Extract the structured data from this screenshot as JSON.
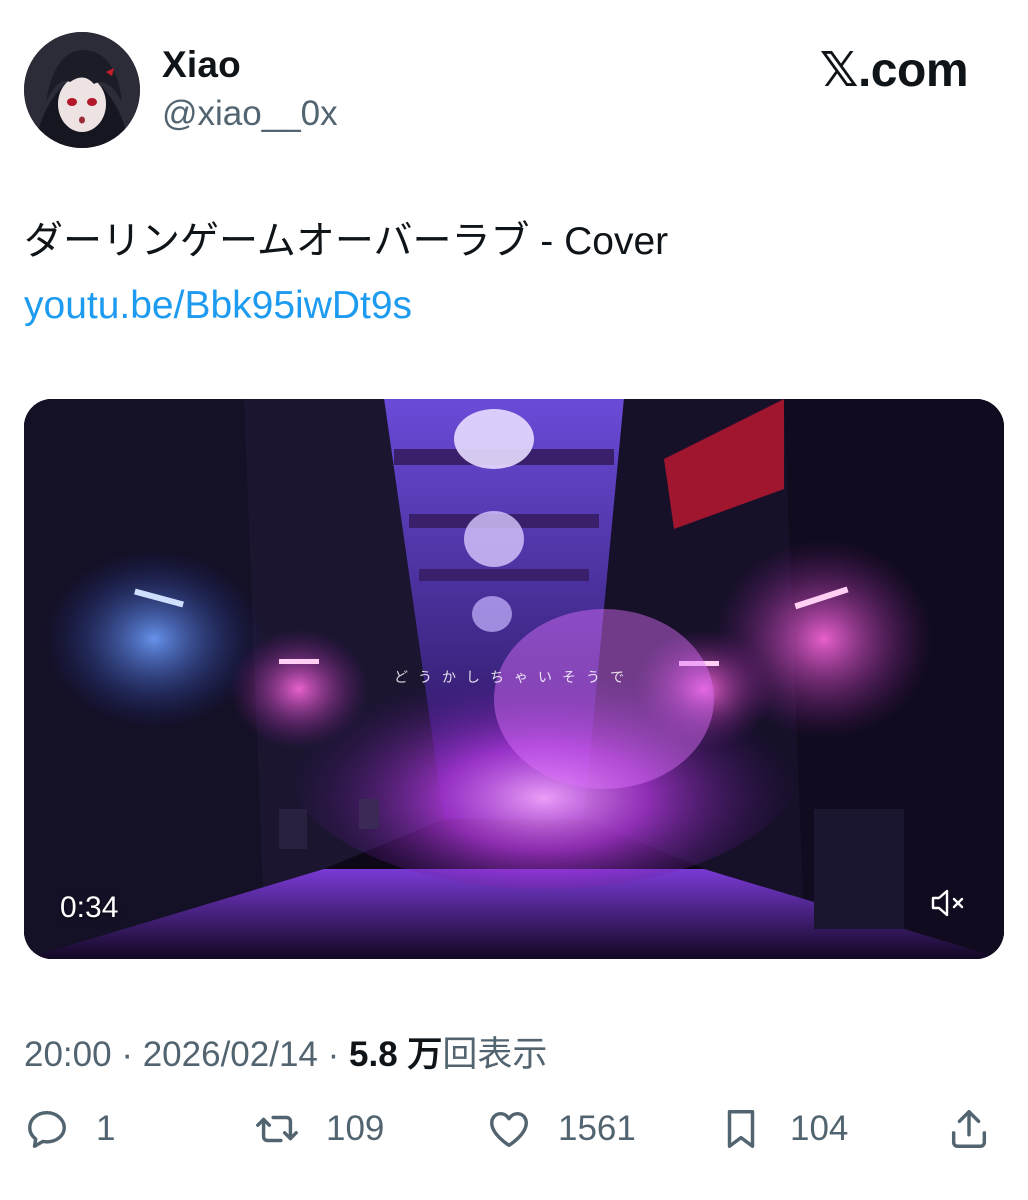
{
  "header": {
    "display_name": "Xiao",
    "handle": "@xiao__0x",
    "brand": "𝕏.com"
  },
  "tweet": {
    "text": "ダーリンゲームオーバーラブ - Cover",
    "link": "youtu.be/Bbk95iwDt9s"
  },
  "video": {
    "timestamp": "0:34",
    "lyric_overlay": "どうかしちゃいそうで"
  },
  "meta": {
    "time": "20:00",
    "separator": "·",
    "date": "2026/02/14",
    "views": "5.8 万",
    "views_suffix": "回表示"
  },
  "actions": {
    "replies": "1",
    "reposts": "109",
    "likes": "1561",
    "bookmarks": "104"
  },
  "colors": {
    "link": "#1d9bf0",
    "secondary_text": "#536471",
    "primary_text": "#0f1419"
  }
}
